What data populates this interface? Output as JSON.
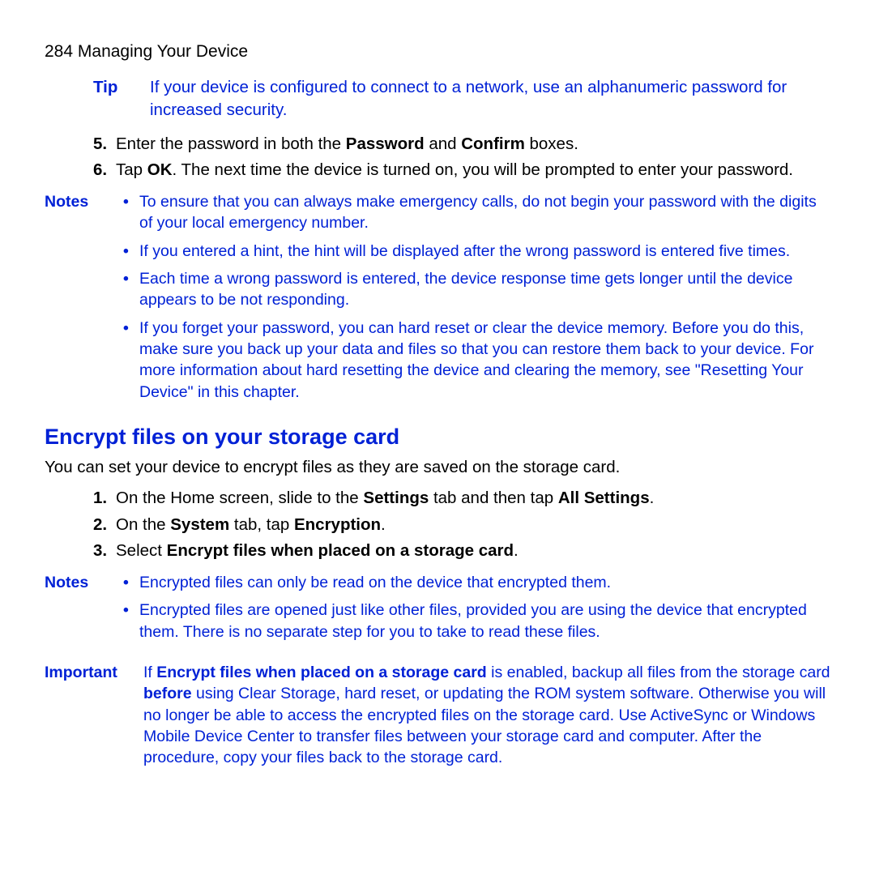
{
  "header": {
    "pageNumber": "284",
    "sectionTitle": "Managing Your Device"
  },
  "tip": {
    "label": "Tip",
    "text": "If your device is configured to connect to a network, use an alphanumeric password for increased security."
  },
  "steps1": [
    {
      "num": "5.",
      "parts": [
        "Enter the password in both the ",
        "Password",
        " and ",
        "Confirm",
        " boxes."
      ]
    },
    {
      "num": "6.",
      "parts": [
        "Tap ",
        "OK",
        ". The next time the device is turned on, you will be prompted to enter your password."
      ]
    }
  ],
  "notes1": {
    "label": "Notes",
    "items": [
      "To ensure that you can always make emergency calls, do not begin your password with the digits of your local emergency number.",
      "If you entered a hint, the hint will be displayed after the wrong password is entered five times.",
      "Each time a wrong password is entered, the device response time gets longer until the device appears to be not responding.",
      "If you forget your password, you can hard reset or clear the device memory. Before you do this, make sure you back up your data and files so that you can restore them back to your device. For more information about hard resetting the device and clearing the memory, see \"Resetting Your Device\" in this chapter."
    ]
  },
  "section": {
    "heading": "Encrypt files on your storage card",
    "intro": "You can set your device to encrypt files as they are saved on the storage card."
  },
  "steps2": [
    {
      "num": "1.",
      "parts": [
        "On the Home screen, slide to the ",
        "Settings",
        " tab and then tap ",
        "All Settings",
        "."
      ]
    },
    {
      "num": "2.",
      "parts": [
        "On the ",
        "System",
        " tab, tap ",
        "Encryption",
        "."
      ]
    },
    {
      "num": "3.",
      "parts": [
        "Select ",
        "Encrypt files when placed on a storage card",
        "."
      ]
    }
  ],
  "notes2": {
    "label": "Notes",
    "items": [
      "Encrypted files can only be read on the device that encrypted them.",
      "Encrypted files are opened just like other files, provided you are using the device that encrypted them. There is no separate step for you to take to read these files."
    ]
  },
  "important": {
    "label": "Important",
    "prefix": "If ",
    "boldPhrase": "Encrypt files when placed on a storage card",
    "middle": " is enabled, backup all files from the storage card ",
    "boldWord": "before",
    "suffix": " using Clear Storage, hard reset, or updating the ROM system software. Otherwise you will no longer be able to access the encrypted files on the storage card. Use ActiveSync or Windows Mobile Device Center to transfer files between your storage card and computer. After the procedure, copy your files back to the storage card."
  },
  "bullet": "•"
}
